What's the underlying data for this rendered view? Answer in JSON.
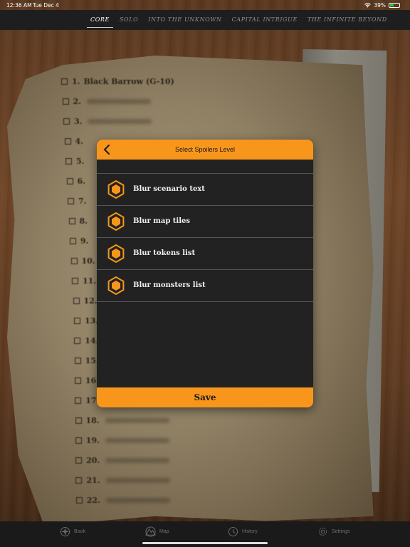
{
  "status": {
    "time": "12:36 AM",
    "date": "Tue Dec 4",
    "battery": "39%",
    "battery_level": 0.39
  },
  "tabs": [
    {
      "label": "CORE",
      "active": true
    },
    {
      "label": "SOLO",
      "active": false
    },
    {
      "label": "INTO THE UNKNOWN",
      "active": false
    },
    {
      "label": "CAPITAL INTRIGUE",
      "active": false
    },
    {
      "label": "THE INFINITE BEYOND",
      "active": false
    }
  ],
  "scenarios": [
    {
      "num": "1.",
      "name": "Black Barrow (G-10)"
    },
    {
      "num": "2."
    },
    {
      "num": "3."
    },
    {
      "num": "4."
    },
    {
      "num": "5."
    },
    {
      "num": "6."
    },
    {
      "num": "7."
    },
    {
      "num": "8."
    },
    {
      "num": "9."
    },
    {
      "num": "10."
    },
    {
      "num": "11."
    },
    {
      "num": "12."
    },
    {
      "num": "13."
    },
    {
      "num": "14."
    },
    {
      "num": "15."
    },
    {
      "num": "16."
    },
    {
      "num": "17."
    },
    {
      "num": "18."
    },
    {
      "num": "19."
    },
    {
      "num": "20."
    },
    {
      "num": "21."
    },
    {
      "num": "22."
    }
  ],
  "modal": {
    "title": "Select Spoilers Level",
    "options": [
      {
        "label": "Blur scenario text"
      },
      {
        "label": "Blur map tiles"
      },
      {
        "label": "Blur tokens list"
      },
      {
        "label": "Blur monsters list"
      }
    ],
    "save_label": "Save"
  },
  "bottom_nav": [
    {
      "label": "Book",
      "icon": "compass-icon"
    },
    {
      "label": "Map",
      "icon": "map-icon"
    },
    {
      "label": "History",
      "icon": "clock-icon"
    },
    {
      "label": "Settings",
      "icon": "gear-icon"
    }
  ],
  "colors": {
    "accent": "#f7961b",
    "modal_bg": "#222222",
    "bar_bg": "#1e1e1e"
  }
}
